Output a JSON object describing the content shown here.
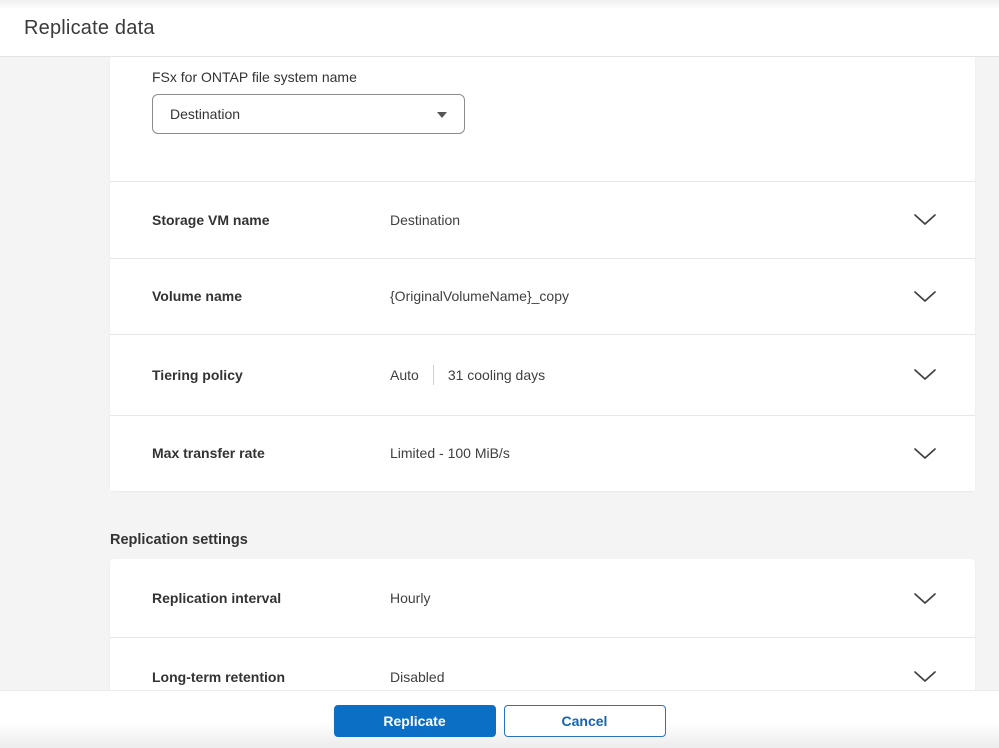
{
  "header": {
    "title": "Replicate data"
  },
  "colors": {
    "primary_blue": "#0C6FC6",
    "body_background": "#F4F4F5",
    "card_background": "#FFFFFF",
    "text": "#333333",
    "row_divider": "#E8E8E8"
  },
  "icons": {
    "caret": "caret-down-icon (filled triangle)",
    "chevron": "chevron-down-icon (thin V stroke)"
  },
  "form": {
    "file_system": {
      "label": "FSx for ONTAP file system name",
      "value": "Destination"
    },
    "rows": [
      {
        "label": "Storage VM name",
        "value": "Destination"
      },
      {
        "label": "Volume name",
        "value": "{OriginalVolumeName}_copy"
      },
      {
        "label": "Tiering policy",
        "value": "Auto",
        "value2": "31 cooling days"
      },
      {
        "label": "Max transfer rate",
        "value": "Limited - 100 MiB/s"
      }
    ]
  },
  "replication_settings": {
    "heading": "Replication settings",
    "rows": [
      {
        "label": "Replication interval",
        "value": "Hourly"
      },
      {
        "label": "Long-term retention",
        "value": "Disabled"
      }
    ]
  },
  "footer": {
    "replicate_label": "Replicate",
    "cancel_label": "Cancel"
  }
}
